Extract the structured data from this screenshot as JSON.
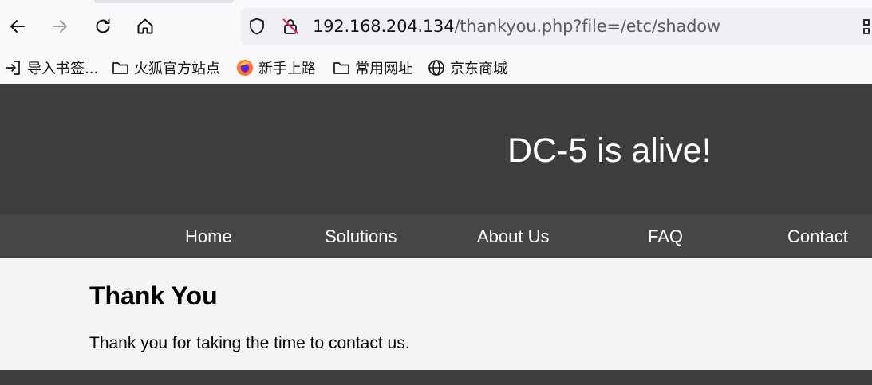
{
  "browser": {
    "url_host": "192.168.204.134",
    "url_path": "/thankyou.php?file=/etc/shadow",
    "bookmarks": [
      {
        "label": "导入书签...",
        "icon": "import-icon"
      },
      {
        "label": "火狐官方站点",
        "icon": "folder-icon"
      },
      {
        "label": "新手上路",
        "icon": "firefox-icon"
      },
      {
        "label": "常用网址",
        "icon": "folder-icon"
      },
      {
        "label": "京东商城",
        "icon": "globe-icon"
      }
    ]
  },
  "site": {
    "title": "DC-5 is alive!",
    "nav": [
      "Home",
      "Solutions",
      "About Us",
      "FAQ",
      "Contact"
    ]
  },
  "content": {
    "heading": "Thank You",
    "text": "Thank you for taking the time to contact us."
  },
  "colors": {
    "header_bg": "#3d3d3d",
    "nav_bg": "#464646",
    "page_bg": "#f4f4f4",
    "firefox_orange": "#ff7139"
  }
}
